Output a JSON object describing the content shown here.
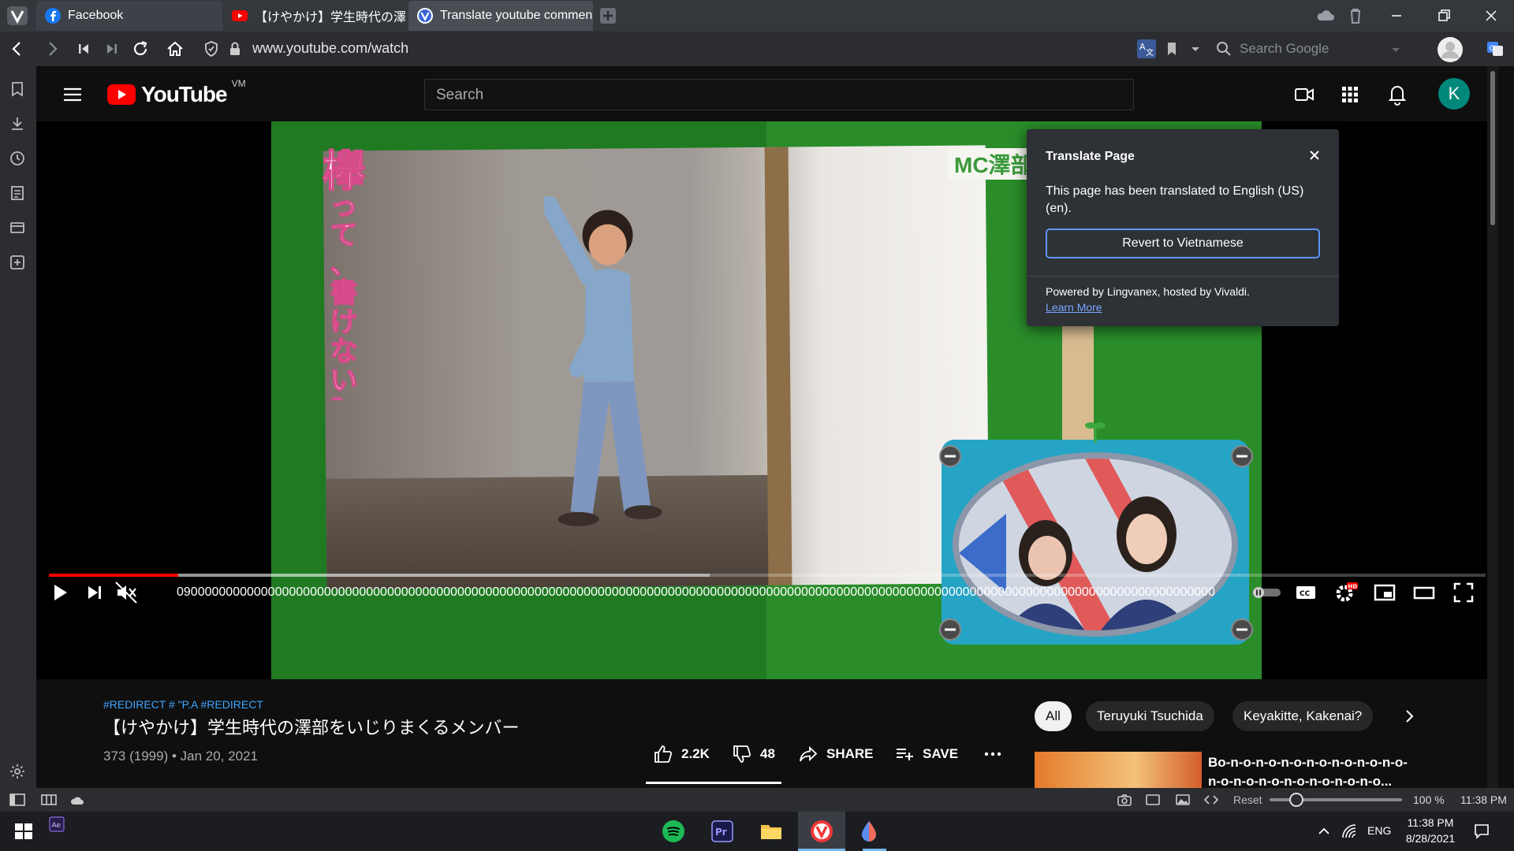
{
  "tabs": [
    {
      "label": "Facebook"
    },
    {
      "label": "【けやかけ】学生時代の澤"
    },
    {
      "label": "Translate youtube commen"
    }
  ],
  "address": {
    "url": "www.youtube.com/watch",
    "search_placeholder": "Search Google"
  },
  "youtube": {
    "logo_text": "YouTube",
    "country_code": "VM",
    "search_placeholder": "Search",
    "avatar_letter": "K"
  },
  "video": {
    "overlay_vertical_text": "欅って、書けない？",
    "overlay_badge": "MC澤部",
    "time_text": "0900000000000000000000000000000000000000000000000000000000000000000000000000000000000000000000000000000000000000000000000000000000000000000000000000",
    "progress_played": 0.09,
    "progress_loaded": 0.46
  },
  "details": {
    "tags": "#REDIRECT # \"P.A #REDIRECT",
    "title": "【けやかけ】学生時代の澤部をいじりまくるメンバー",
    "meta": "373 (1999) • Jan 20, 2021",
    "likes": "2.2K",
    "dislikes": "48",
    "share_label": "SHARE",
    "save_label": "SAVE"
  },
  "chips": [
    {
      "label": "All"
    },
    {
      "label": "Teruyuki Tsuchida"
    },
    {
      "label": "Keyakitte, Kakenai?"
    }
  ],
  "related": {
    "title": "Bo-n-o-n-o-n-o-n-o-n-o-n-o-n-o-n-o-n-o-n-o-n-o-n-o-n-o-n-o..."
  },
  "popup": {
    "title": "Translate Page",
    "body": "This page has been translated to English (US) (en).",
    "button": "Revert to Vietnamese",
    "footer": "Powered by Lingvanex, hosted by Vivaldi.",
    "link": "Learn More"
  },
  "statusbar": {
    "reset_label": "Reset",
    "zoom": "100 %",
    "zoom_level": 0.2,
    "time": "11:38 PM"
  },
  "taskbar": {
    "lang": "ENG",
    "time": "11:38 PM",
    "date": "8/28/2021"
  },
  "colors": {
    "accent_red": "#ff0000",
    "link_blue": "#3ea6ff",
    "popup_button_border": "#5e95ff",
    "avatar_bg": "#00897b"
  }
}
